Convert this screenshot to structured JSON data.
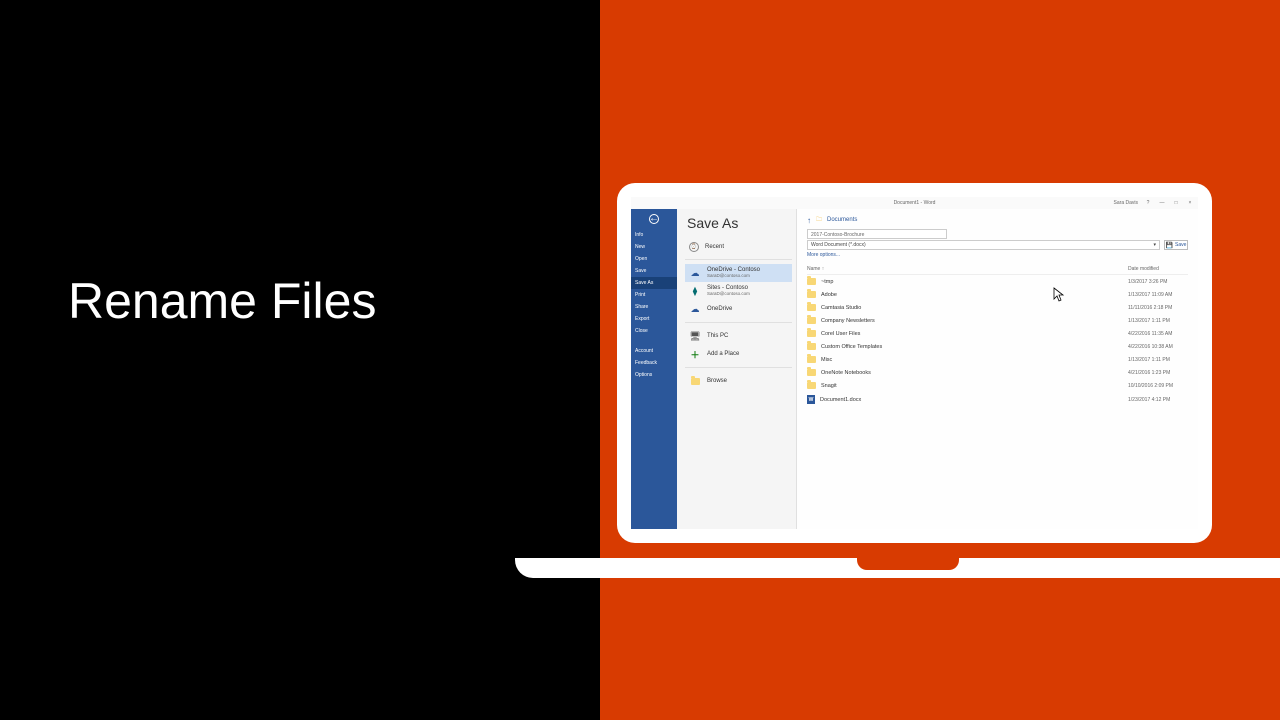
{
  "slide_title": "Rename Files",
  "titlebar": {
    "doc": "Document1 - Word",
    "user": "Sara Davis",
    "help": "?",
    "min": "—",
    "max": "□",
    "close": "×"
  },
  "backstage": {
    "items": [
      "Info",
      "New",
      "Open",
      "Save",
      "Save As",
      "Print",
      "Share",
      "Export",
      "Close"
    ],
    "active_index": 4,
    "bottom_items": [
      "Account",
      "Feedback",
      "Options"
    ]
  },
  "page_heading": "Save As",
  "locations": [
    {
      "kind": "recent",
      "label": "Recent"
    },
    {
      "kind": "onedrive",
      "label": "OneDrive - Contoso",
      "sub": "SaraD@contoso.com",
      "active": true
    },
    {
      "kind": "sharepoint",
      "label": "Sites - Contoso",
      "sub": "SaraD@contoso.com"
    },
    {
      "kind": "onedrive",
      "label": "OneDrive"
    },
    {
      "kind": "thispc",
      "label": "This PC"
    },
    {
      "kind": "addplace",
      "label": "Add a Place"
    },
    {
      "kind": "browse",
      "label": "Browse"
    }
  ],
  "breadcrumb": {
    "folder": "Documents"
  },
  "filename": "2017-Contoso-Brochure",
  "filetype": "Word Document (*.docx)",
  "save_label": "Save",
  "more_options": "More options...",
  "columns": {
    "name": "Name ↑",
    "date": "Date modified"
  },
  "files": [
    {
      "type": "folder",
      "name": "~tmp",
      "date": "1/3/2017 3:26 PM"
    },
    {
      "type": "folder",
      "name": "Adobe",
      "date": "1/13/2017 11:09 AM"
    },
    {
      "type": "folder",
      "name": "Camtasia Studio",
      "date": "11/11/2016 2:18 PM"
    },
    {
      "type": "folder",
      "name": "Company Newsletters",
      "date": "1/13/2017 1:11 PM"
    },
    {
      "type": "folder",
      "name": "Corel User Files",
      "date": "4/22/2016 11:35 AM"
    },
    {
      "type": "folder",
      "name": "Custom Office Templates",
      "date": "4/22/2016 10:38 AM"
    },
    {
      "type": "folder",
      "name": "Misc",
      "date": "1/13/2017 1:11 PM"
    },
    {
      "type": "folder",
      "name": "OneNote Notebooks",
      "date": "4/21/2016 1:23 PM"
    },
    {
      "type": "folder",
      "name": "Snagit",
      "date": "10/10/2016 2:09 PM"
    },
    {
      "type": "docx",
      "name": "Document1.docx",
      "date": "1/23/2017 4:12 PM"
    }
  ]
}
